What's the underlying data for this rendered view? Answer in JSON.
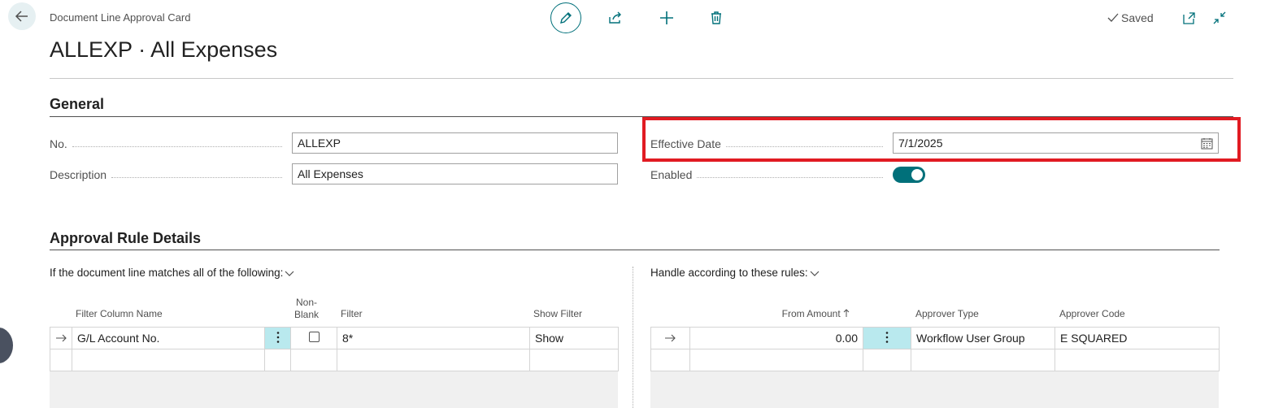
{
  "header": {
    "back_icon": "arrow-left-icon",
    "caption": "Document Line Approval Card",
    "title": "ALLEXP · All Expenses",
    "toolbar": {
      "edit_icon": "pencil-icon",
      "share_icon": "share-icon",
      "new_icon": "plus-icon",
      "delete_icon": "trash-icon"
    },
    "saved_label": "Saved",
    "open_new_window_icon": "open-in-new-window-icon",
    "collapse_icon": "collapse-icon"
  },
  "general": {
    "title": "General",
    "no_label": "No.",
    "no_value": "ALLEXP",
    "description_label": "Description",
    "description_value": "All Expenses",
    "effective_date_label": "Effective Date",
    "effective_date_value": "7/1/2025",
    "calendar_icon": "calendar-icon",
    "enabled_label": "Enabled",
    "enabled_value": true
  },
  "approval_rules": {
    "title": "Approval Rule Details",
    "left": {
      "caption": "If the document line matches all of the following:",
      "columns": {
        "filter_column_name": "Filter Column Name",
        "non_blank": "Non-\nBlank",
        "filter": "Filter",
        "show_filter": "Show Filter"
      },
      "rows": [
        {
          "filter_column_name": "G/L Account No.",
          "non_blank": false,
          "filter": "8*",
          "show_filter": "Show"
        }
      ]
    },
    "right": {
      "caption": "Handle according to these rules:",
      "columns": {
        "from_amount": "From Amount",
        "sort_icon": "arrow-up-icon",
        "approver_type": "Approver Type",
        "approver_code": "Approver Code"
      },
      "rows": [
        {
          "from_amount": "0.00",
          "approver_type": "Workflow User Group",
          "approver_code": "E SQUARED"
        }
      ]
    }
  },
  "colors": {
    "accent": "#00707a",
    "highlight": "#e11b22",
    "selected_cell": "#b9e9ee"
  }
}
